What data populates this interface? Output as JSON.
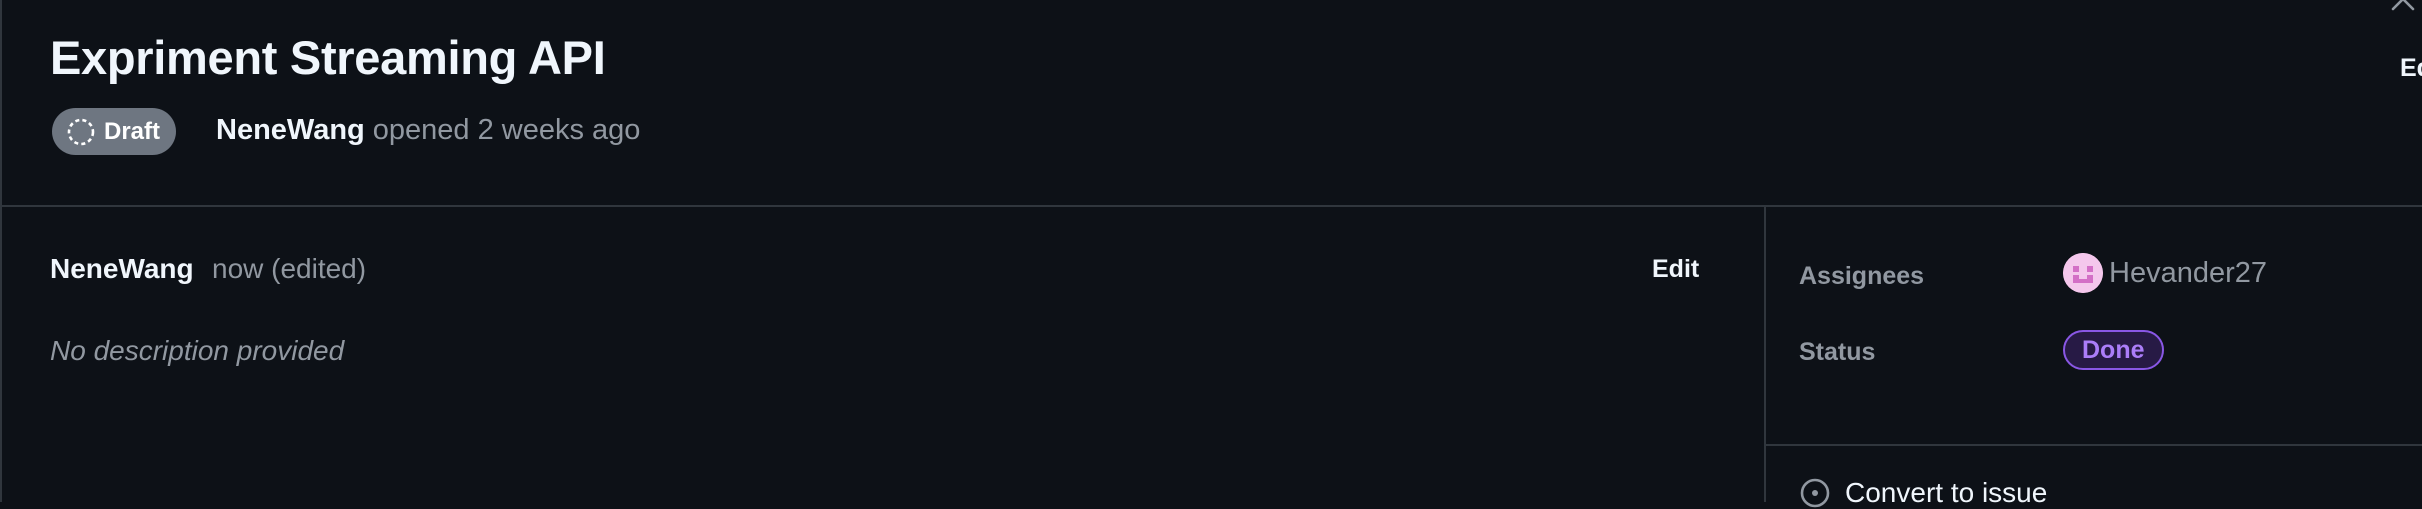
{
  "header": {
    "title": "Expriment Streaming API",
    "state_badge": "Draft",
    "author": "NeneWang",
    "opened_text": "opened 2 weeks ago",
    "edit_label": "Ed"
  },
  "comment": {
    "author": "NeneWang",
    "timestamp": "now (edited)",
    "edit_label": "Edit",
    "body": "No description provided"
  },
  "sidebar": {
    "assignees_label": "Assignees",
    "assignee_name": "Hevander27",
    "status_label": "Status",
    "status_value": "Done",
    "convert_label": "Convert to issue"
  },
  "colors": {
    "background": "#0d1117",
    "draft_badge": "#6e7681",
    "status_done": "#ab7df8",
    "avatar": "#f4c7ec"
  },
  "icons": [
    "draft-icon",
    "close-icon",
    "avatar",
    "convert-issue-icon"
  ]
}
